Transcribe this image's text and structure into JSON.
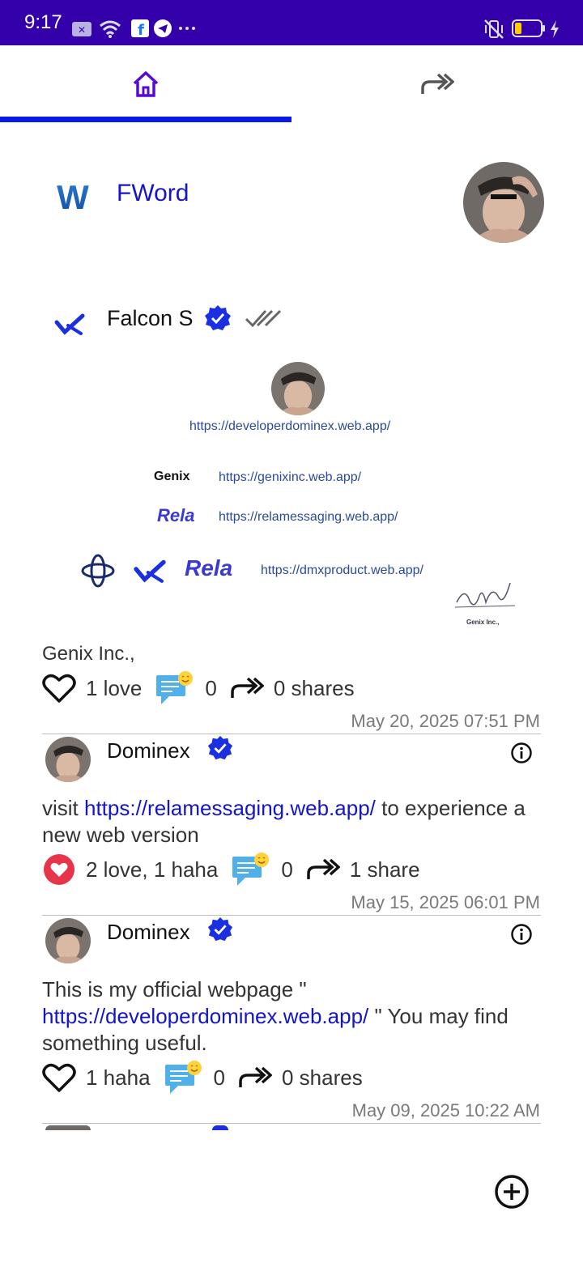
{
  "status_bar": {
    "time": "9:17"
  },
  "tabs": [
    {
      "name": "home",
      "icon": "home-icon",
      "active": true
    },
    {
      "name": "share",
      "icon": "double-arrow-share-icon",
      "active": false
    }
  ],
  "header": {
    "title": "FWord",
    "logo_letter": "W"
  },
  "pinned": {
    "name": "Falcon S",
    "links": {
      "developer": "https://developerdominex.web.app/",
      "genix": "https://genixinc.web.app/",
      "rela": "https://relamessaging.web.app/",
      "dmx": "https://dmxproduct.web.app/"
    },
    "brand_genix": "Genix",
    "brand_rela": "Rela",
    "signature_caption": "Genix Inc.,",
    "author_line": "Genix Inc.,",
    "reactions": "1 love",
    "comments": "0",
    "shares": "0 shares",
    "date": "May 20, 2025 07:51 PM"
  },
  "posts": [
    {
      "author": "Dominex",
      "body_prefix": "visit ",
      "body_link": "https://relamessaging.web.app/",
      "body_suffix": " to experience a new web version",
      "reactions": "2 love, 1 haha",
      "comments": "0",
      "shares": "1 share",
      "date": "May 15, 2025 06:01 PM"
    },
    {
      "author": "Dominex",
      "body_prefix": "This is my official webpage \" ",
      "body_link": "https://developerdominex.web.app/",
      "body_suffix": "  \" You may find something useful.",
      "reactions": "1 haha",
      "comments": "0",
      "shares": "0 shares",
      "date": "May 09, 2025 10:22 AM"
    }
  ],
  "colors": {
    "status_bar": "#3300aa",
    "accent": "#0a1ae6",
    "link": "#1515c8",
    "verified": "#1a2fe0"
  }
}
